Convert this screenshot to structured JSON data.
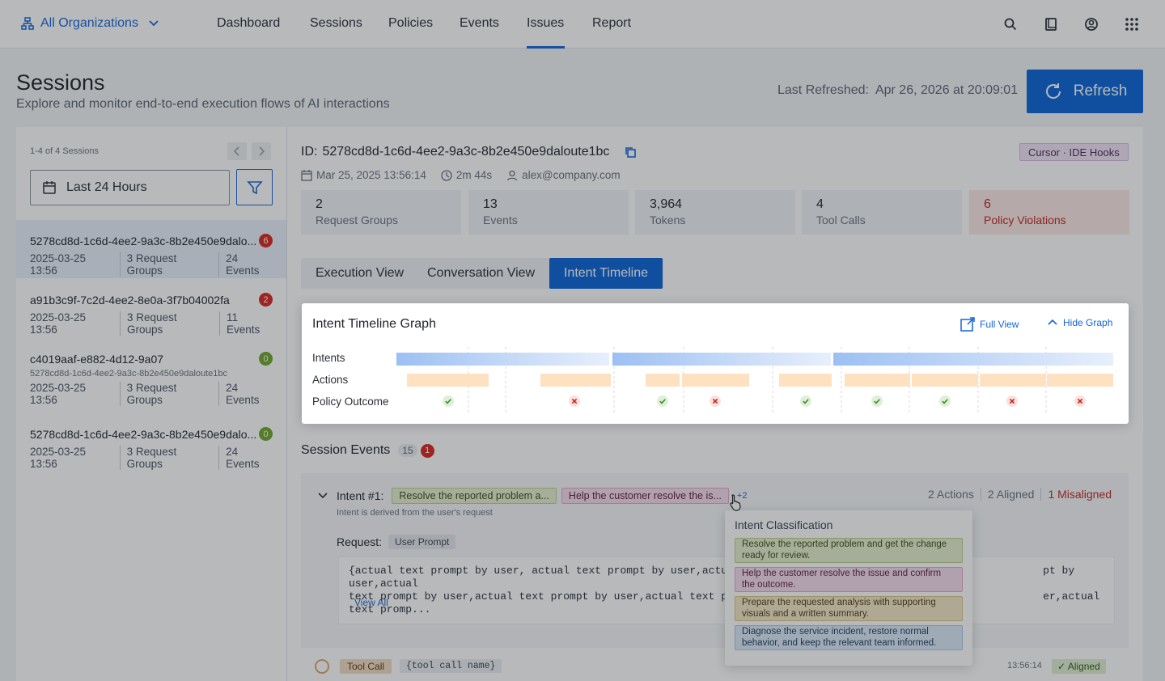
{
  "nav": {
    "org_label": "All Organizations",
    "items": [
      "Dashboard",
      "Sessions",
      "Policies",
      "Events",
      "Issues",
      "Report"
    ],
    "active": "Issues",
    "icons": [
      "search-icon",
      "book-icon",
      "user-circle-icon",
      "apps-grid-icon"
    ]
  },
  "header": {
    "title": "Sessions",
    "subtitle": "Explore and monitor end-to-end execution flows of AI interactions",
    "last_refreshed": "Last Refreshed:  Apr 26, 2026 at 20:09:01",
    "refresh_label": "Refresh"
  },
  "sidebar": {
    "count": "1-4 of 4 Sessions",
    "date_filter": "Last 24 Hours",
    "sessions": [
      {
        "id": "5278cd8d-1c6d-4ee2-9a3c-8b2e450e9dalo...",
        "date": "2025-03-25 13:56",
        "groups": "3 Request Groups",
        "events": "24 Events",
        "badge": "6",
        "badge_color": "#d9261c"
      },
      {
        "id": "a91b3c9f-7c2d-4ee2-8e0a-3f7b04002fa",
        "date": "2025-03-25 13:56",
        "groups": "3 Request Groups",
        "events": "11 Events",
        "badge": "2",
        "badge_color": "#d9261c"
      },
      {
        "id": "c4019aaf-e882-4d12-9a07",
        "sub": "5278cd8d-1c6d-4ee2-9a3c-8b2e450e9daloute1bc",
        "date": "2025-03-25 13:56",
        "groups": "3 Request Groups",
        "events": "24 Events",
        "badge": "0",
        "badge_color": "#6fa52a"
      },
      {
        "id": "5278cd8d-1c6d-4ee2-9a3c-8b2e450e9dalo...",
        "date": "2025-03-25 13:56",
        "groups": "3 Request Groups",
        "events": "24 Events",
        "badge": "0",
        "badge_color": "#6fa52a"
      }
    ]
  },
  "session": {
    "id_label": "ID:",
    "id": "5278cd8d-1c6d-4ee2-9a3c-8b2e450e9daloute1bc",
    "source_tag": "Cursor · IDE Hooks",
    "date": "Mar 25, 2025 13:56:14",
    "duration": "2m 44s",
    "user": "alex@company.com",
    "stats": [
      {
        "value": "2",
        "label": "Request Groups"
      },
      {
        "value": "13",
        "label": "Events"
      },
      {
        "value": "3,964",
        "label": "Tokens"
      },
      {
        "value": "4",
        "label": "Tool Calls"
      },
      {
        "value": "6",
        "label": "Policy Violations"
      }
    ]
  },
  "tabs": [
    "Execution View",
    "Conversation View",
    "Intent Timeline"
  ],
  "active_tab": "Intent Timeline",
  "graph": {
    "title": "Intent Timeline Graph",
    "full_view": "Full View",
    "hide_graph": "Hide Graph",
    "row_labels": [
      "Intents",
      "Actions",
      "Policy Outcome"
    ],
    "outcomes": [
      "pass",
      "fail",
      "pass",
      "fail",
      "pass",
      "pass",
      "pass",
      "fail",
      "fail"
    ]
  },
  "events": {
    "title": "Session Events",
    "count": "15",
    "alert": "1",
    "intent_label": "Intent #1:",
    "intent_chip_1": "Resolve the reported problem a...",
    "intent_chip_2": "Help the customer resolve the is...",
    "intent_more": "+2",
    "stats": [
      "2 Actions",
      "2 Aligned",
      "1 Misaligned"
    ],
    "intent_desc": "Intent is derived from the user's request",
    "request_label": "Request:",
    "request_chip": "User Prompt",
    "prompt_line1": "{actual text prompt by user, actual text prompt by user,actu                                                  pt by user,actual",
    "prompt_line2": "text prompt by user,actual text prompt by user,actual text p                                                  er,actual text promp...",
    "view_all": "View All",
    "tool_chip": "Tool Call",
    "tool_name": "{tool call name}",
    "tool_time": "13:56:14",
    "tool_status": "✓ Aligned"
  },
  "popover": {
    "title": "Intent Classification",
    "items": [
      {
        "text": "Resolve the reported problem and get the change ready for review.",
        "style": "olive"
      },
      {
        "text": "Help the customer resolve the issue and confirm the outcome.",
        "style": "pink"
      },
      {
        "text": "Prepare the requested analysis with supporting visuals and a written summary.",
        "style": "tan"
      },
      {
        "text": "Diagnose the service incident, restore normal behavior, and keep the relevant team informed.",
        "style": "blue"
      }
    ]
  }
}
